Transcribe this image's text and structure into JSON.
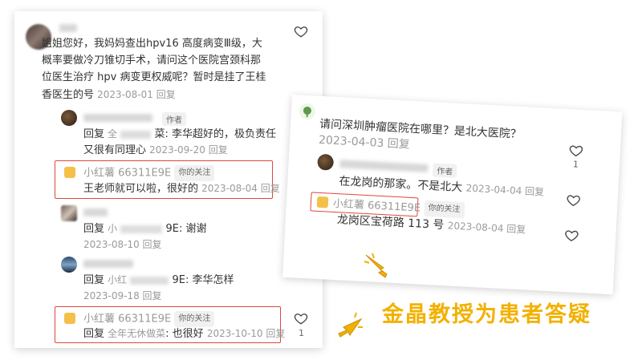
{
  "left_card": {
    "main_comment": {
      "line1": "姐姐您好，我妈妈查出hpv16 高度病变Ⅲ级，大",
      "line2": "概率要做冷刀锥切手术，请问这个医院宫颈科那",
      "line3": "位医生治疗 hpv 病变更权威呢？暂时是挂了王桂",
      "line4": "香医生的号",
      "meta": "2023-08-01 回复"
    },
    "reply1": {
      "author_badge": "作者",
      "line1_prefix": "回复",
      "line1_pixelated": "全",
      "line1_text": "菜: 李华超好的，极负责任",
      "line2": "又很有同理心",
      "meta": "2023-09-20 回复"
    },
    "reply2": {
      "name": "小红薯 66311E9E",
      "follow_badge": "你的关注",
      "text": "王老师就可以啦，很好的",
      "meta": "2023-08-04 回复"
    },
    "reply3": {
      "prefix": "回复",
      "pixelated": "小",
      "text": "9E: 谢谢",
      "meta": "2023-08-10 回复"
    },
    "reply4": {
      "prefix": "回复",
      "pixelated": "小红",
      "text": "9E: 李华怎样",
      "meta": "2023-09-18 回复"
    },
    "reply5": {
      "name": "小红薯 66311E9E",
      "follow_badge": "你的关注",
      "prefix": "回复",
      "mention": "全年无休做菜",
      "text": ": 也很好",
      "meta": "2023-10-10 回复"
    },
    "like_count_bottom": "1"
  },
  "right_card": {
    "comment": {
      "text": "请问深圳肿瘤医院在哪里？是北大医院？",
      "meta": "2023-04-03 回复",
      "like_count": "1"
    },
    "reply1": {
      "author_badge": "作者",
      "text": "在龙岗的那家。不是北大",
      "meta": "2023-04-04 回复"
    },
    "reply2": {
      "name": "小红薯 66311E9E",
      "follow_badge": "你的关注",
      "text": "龙岗区宝荷路 113 号",
      "meta": "2023-08-04 回复"
    }
  },
  "caption": "金晶教授为患者答疑",
  "colors": {
    "highlight_box": "#e0463e",
    "caption": "#f2b100",
    "meta_gray": "#9a9a9a"
  }
}
